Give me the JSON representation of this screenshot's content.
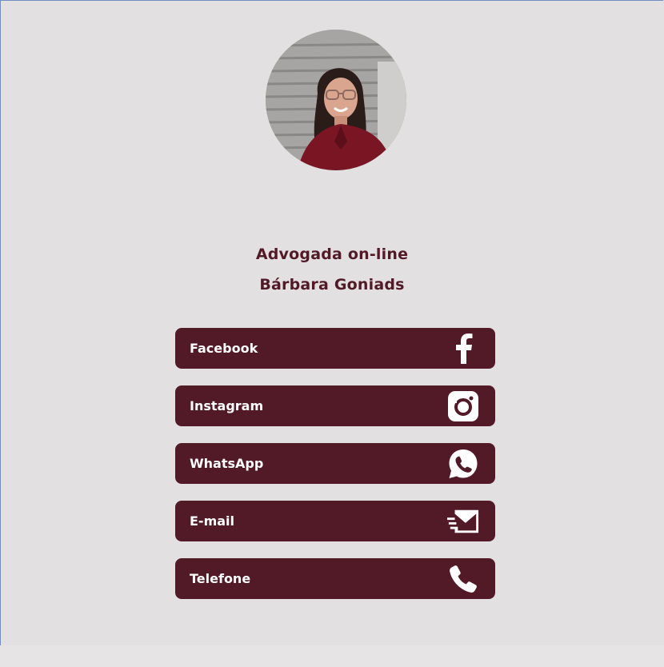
{
  "profile": {
    "avatar_icon": "profile-photo",
    "title": "Advogada on-line",
    "name": "Bárbara Goniads"
  },
  "links": [
    {
      "label": "Facebook",
      "icon": "facebook-icon"
    },
    {
      "label": "Instagram",
      "icon": "instagram-icon"
    },
    {
      "label": "WhatsApp",
      "icon": "whatsapp-icon"
    },
    {
      "label": "E-mail",
      "icon": "email-icon"
    },
    {
      "label": "Telefone",
      "icon": "phone-icon"
    }
  ],
  "colors": {
    "background": "#e2e0e0",
    "accent": "#521a27",
    "button_text": "#ffffff"
  }
}
